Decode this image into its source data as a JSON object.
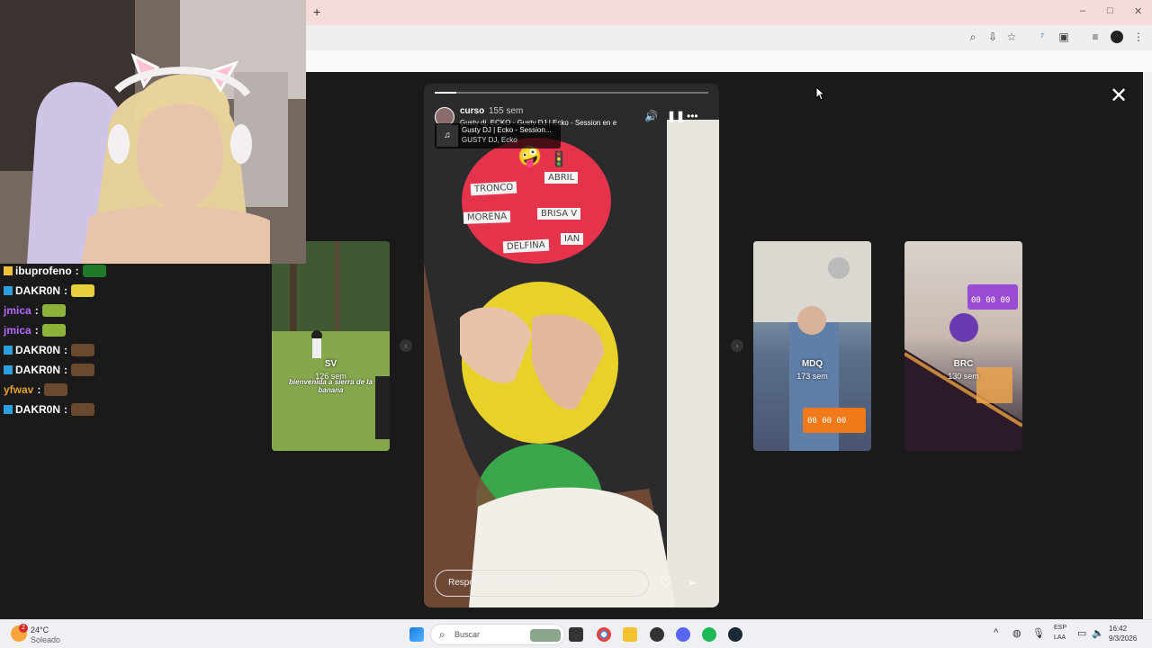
{
  "browser": {
    "new_tab_label": "+",
    "window_controls": {
      "minimize": "–",
      "maximize": "□",
      "close": "✕"
    },
    "toolbar_icons": [
      "zoom-icon",
      "install-icon",
      "star-icon",
      "extension-1-icon",
      "extensions-icon",
      "media-icon",
      "profile-icon",
      "menu-icon"
    ]
  },
  "stories": {
    "close_label": "✕",
    "prev_arrow": "‹",
    "next_arrow": "›",
    "left_card": {
      "name": "SV",
      "time": "126 sem",
      "caption": "bienvenida a sierra de la banana"
    },
    "right_cards": [
      {
        "name": "MDQ",
        "time": "173 sem"
      },
      {
        "name": "BRC",
        "time": "130 sem"
      }
    ],
    "active": {
      "username": "curso",
      "time": "155 sem",
      "music_line": "Gusty dj, ECKO · Gusty DJ | Ecko - Session en e",
      "music_title": "Gusty DJ | Ecko - Session...",
      "music_artist": "GUSTY DJ, Ecko",
      "reply_placeholder": "Responder a condarcoxxiii...",
      "progress": 0.08,
      "names_on_board": [
        "TRONCO",
        "ABRIL",
        "MORENA",
        "BRISA V",
        "DELFINA",
        "IAN"
      ]
    }
  },
  "chat": {
    "lines": [
      {
        "user": "ibuprofeno",
        "color": "#ffffff"
      },
      {
        "user": "DAKR0N",
        "color": "#ffffff"
      },
      {
        "user": "jmica",
        "color": "#b36bff"
      },
      {
        "user": "jmica",
        "color": "#b36bff"
      },
      {
        "user": "DAKR0N",
        "color": "#ffffff"
      },
      {
        "user": "DAKR0N",
        "color": "#ffffff"
      },
      {
        "user": "yfwav",
        "color": "#e0a030"
      },
      {
        "user": "DAKR0N",
        "color": "#ffffff"
      }
    ],
    "separator": ":"
  },
  "taskbar": {
    "weather_temp": "24°C",
    "weather_desc": "Soleado",
    "search_placeholder": "Buscar",
    "lang_1": "ESP",
    "lang_2": "LAA",
    "time": "16:42",
    "date": "9/3/2026",
    "notif_count": "2"
  }
}
